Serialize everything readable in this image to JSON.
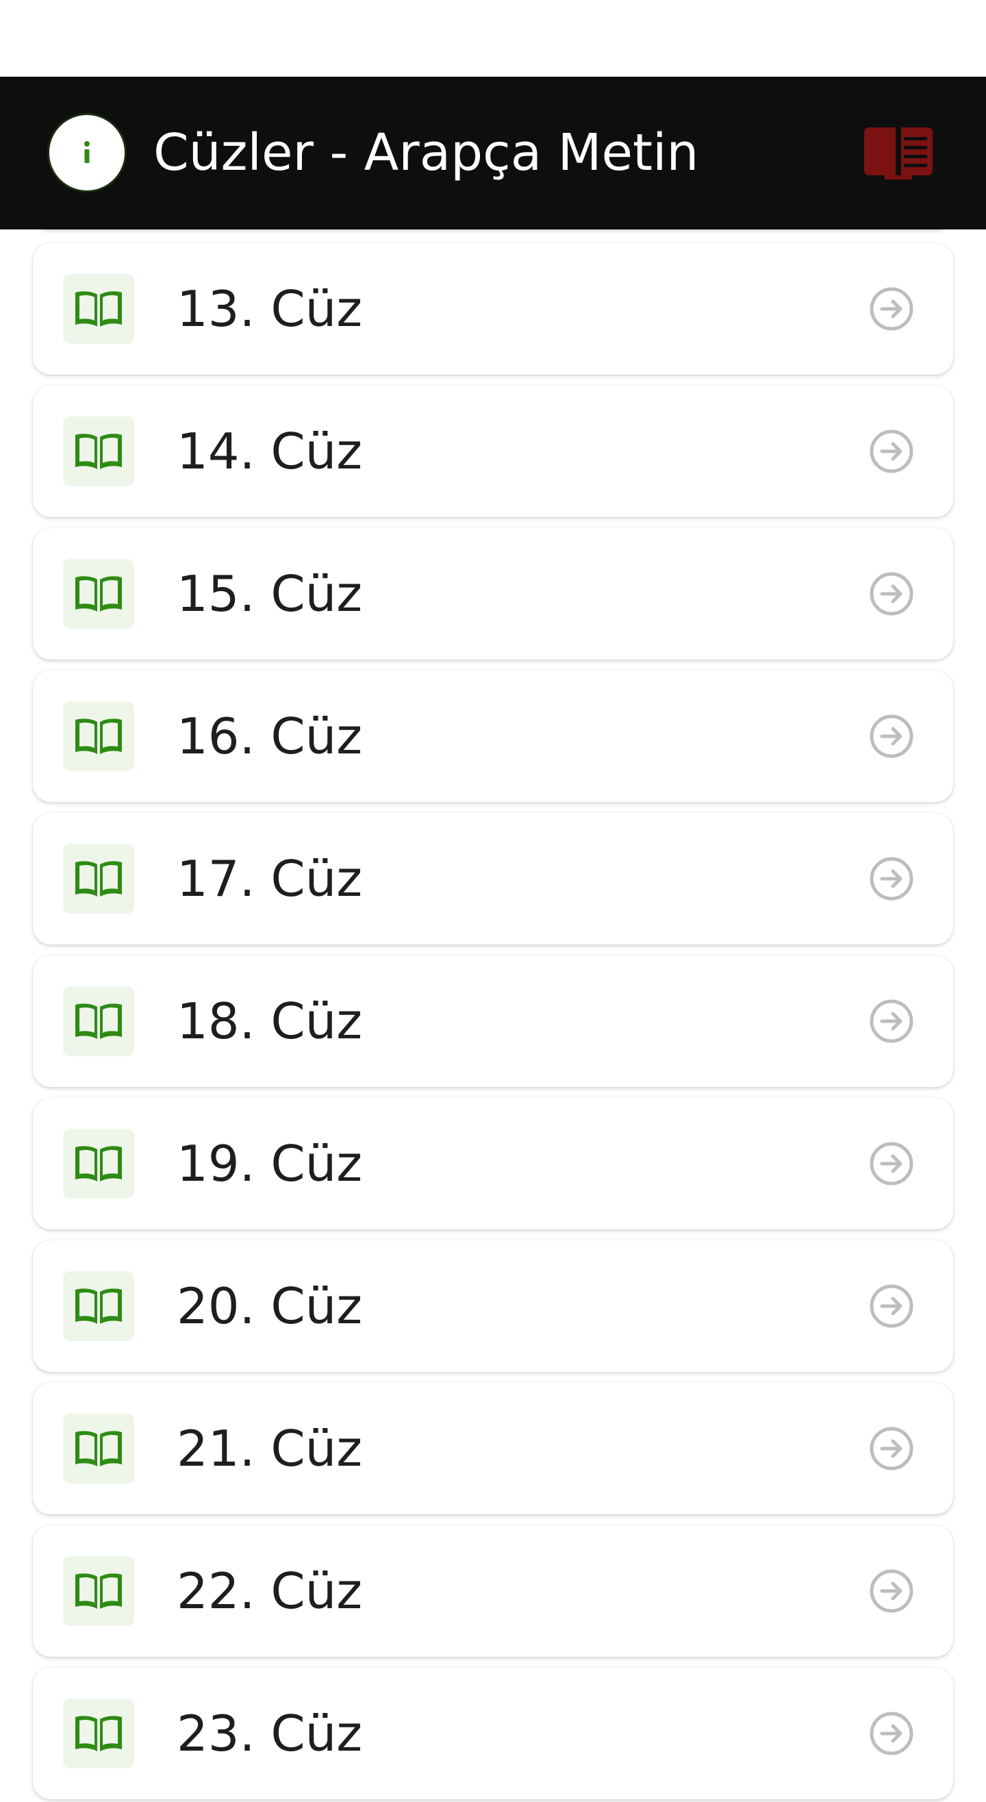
{
  "app_bar": {
    "title": "Cüzler - Arapça Metin",
    "info_icon": "info-icon",
    "book_icon": "book-reader-icon"
  },
  "colors": {
    "app_bar_bg": "#0e0e0e",
    "book_icon": "#7a1212",
    "item_icon": "#2e8b13",
    "item_icon_bg": "#eef6ea",
    "arrow": "#bdbdbd",
    "text": "#1e1e1e"
  },
  "items": [
    {
      "label": "13. Cüz"
    },
    {
      "label": "14. Cüz"
    },
    {
      "label": "15. Cüz"
    },
    {
      "label": "16. Cüz"
    },
    {
      "label": "17. Cüz"
    },
    {
      "label": "18. Cüz"
    },
    {
      "label": "19. Cüz"
    },
    {
      "label": "20. Cüz"
    },
    {
      "label": "21. Cüz"
    },
    {
      "label": "22. Cüz"
    },
    {
      "label": "23. Cüz"
    }
  ]
}
